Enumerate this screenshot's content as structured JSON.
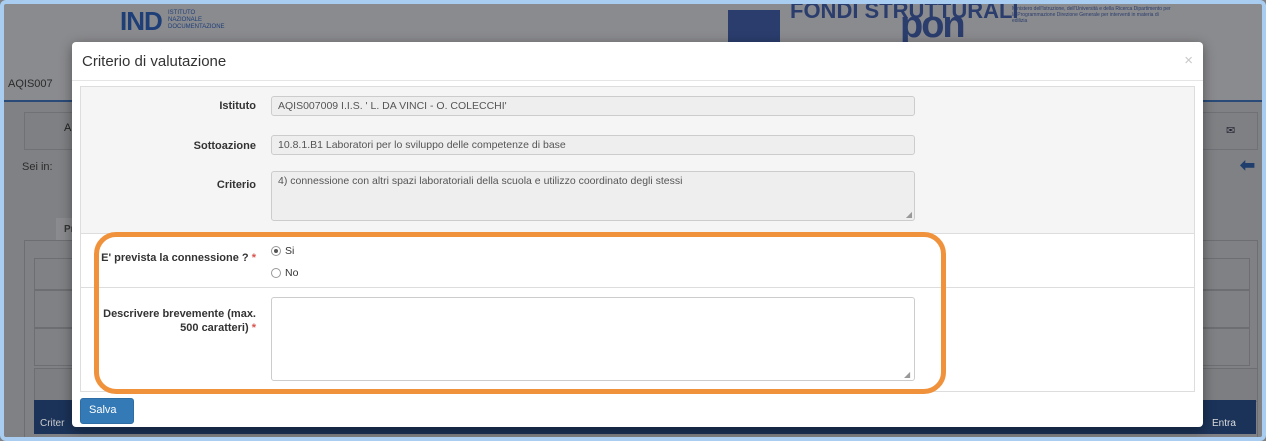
{
  "background": {
    "logo_ind": "IND",
    "logo_ind_sub": "ISTITUTO NAZIONALE DOCUMENTAZIONE",
    "logo_fondi": "FONDI STRUTTURALI",
    "logo_pon": "pon",
    "ministry_text": "Ministero dell'Istruzione, dell'Università e della Ricerca Dipartimento per la Programmazione Direzione Generale per interventi in materia di edilizia",
    "tab_code": "AQIS007",
    "nav_letter": "A",
    "breadcrumb_prefix": "Sei in:",
    "tab_partial": "Pr",
    "table_col_first": "Criter",
    "table_col_last": "Entra"
  },
  "modal": {
    "title": "Criterio di valutazione",
    "close": "×",
    "fields": {
      "istituto": {
        "label": "Istituto",
        "value": "AQIS007009 I.I.S. ' L. DA VINCI - O. COLECCHI'"
      },
      "sottoazione": {
        "label": "Sottoazione",
        "value": "10.8.1.B1 Laboratori per lo sviluppo delle competenze di base"
      },
      "criterio": {
        "label": "Criterio",
        "value": "4) connessione con altri spazi laboratoriali della scuola e utilizzo coordinato degli stessi"
      },
      "connessione": {
        "label": "E' prevista la connessione ?",
        "required_mark": "*",
        "options": [
          {
            "label": "Si",
            "checked": true
          },
          {
            "label": "No",
            "checked": false
          }
        ]
      },
      "descrizione": {
        "label_line1": "Descrivere brevemente (max.",
        "label_line2": "500 caratteri)",
        "required_mark": "*",
        "value": ""
      }
    },
    "save_button": "Salva"
  },
  "colors": {
    "primary_button": "#337ab7",
    "highlight": "#f0923c",
    "required": "#d9534f"
  }
}
